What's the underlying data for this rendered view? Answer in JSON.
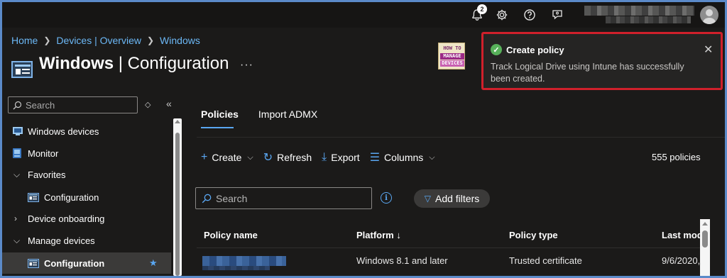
{
  "topbar": {
    "notification_count": "2",
    "icons": [
      "bell-icon",
      "gear-icon",
      "help-icon",
      "feedback-icon",
      "avatar"
    ]
  },
  "breadcrumb": {
    "items": [
      "Home",
      "Devices | Overview",
      "Windows"
    ]
  },
  "page": {
    "title_bold": "Windows",
    "title_rest": " | Configuration",
    "more": "···"
  },
  "logo": {
    "line1": "HOW TO",
    "line2": "MANAGE",
    "line3": "DEVICES"
  },
  "sidebar": {
    "search_placeholder": "Search",
    "sort_glyph": "◇",
    "collapse_glyph": "«",
    "items": [
      {
        "label": "Windows devices",
        "icon": "windows-devices-icon"
      },
      {
        "label": "Monitor",
        "icon": "monitor-icon"
      },
      {
        "label": "Favorites",
        "icon": "chevron-down-icon"
      },
      {
        "label": "Configuration",
        "icon": "configuration-icon"
      },
      {
        "label": "Device onboarding",
        "icon": "chevron-right-icon"
      },
      {
        "label": "Manage devices",
        "icon": "chevron-down-icon"
      },
      {
        "label": "Configuration",
        "icon": "configuration-icon",
        "selected": true,
        "starred": true
      }
    ]
  },
  "tabs": [
    {
      "label": "Policies",
      "active": true
    },
    {
      "label": "Import ADMX",
      "active": false
    }
  ],
  "toolbar": {
    "create": "Create",
    "refresh": "Refresh",
    "export": "Export",
    "columns": "Columns",
    "count": "555 policies"
  },
  "filters": {
    "search_placeholder": "Search",
    "add_filters": "Add filters"
  },
  "table": {
    "headers": [
      "Policy name",
      "Platform ↓",
      "Policy type",
      "Last mod"
    ],
    "rows": [
      {
        "platform": "Windows 8.1 and later",
        "policy_type": "Trusted certificate",
        "last_modified": "9/6/2020,"
      }
    ]
  },
  "toast": {
    "title": "Create policy",
    "message": "Track Logical Drive using Intune has successfully been created.",
    "status_color": "#57b05a",
    "highlight_color": "#d0202b"
  },
  "colors": {
    "accent": "#5aa7f2",
    "link": "#6cb8f6",
    "background": "#1b1a19"
  }
}
